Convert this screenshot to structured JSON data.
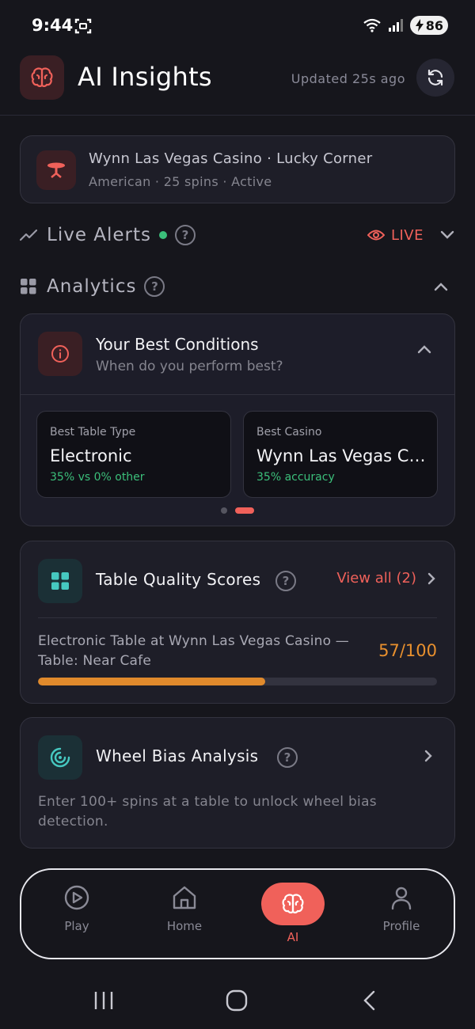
{
  "status_bar": {
    "time": "9:44",
    "battery": "86"
  },
  "header": {
    "title": "AI Insights",
    "updated": "Updated 25s ago"
  },
  "session": {
    "title": "Wynn Las Vegas Casino · Lucky Corner",
    "subtitle": "American · 25 spins · Active"
  },
  "live_alerts": {
    "title": "Live Alerts",
    "live_label": "LIVE"
  },
  "analytics": {
    "title": "Analytics"
  },
  "best_conditions": {
    "title": "Your Best Conditions",
    "subtitle": "When do you perform best?",
    "tiles": [
      {
        "label": "Best Table Type",
        "value": "Electronic",
        "note": "35% vs 0% other"
      },
      {
        "label": "Best Casino",
        "value": "Wynn Las Vegas Casino",
        "note": "35% accuracy"
      }
    ],
    "page_count": 2,
    "active_page": 1
  },
  "table_quality": {
    "title": "Table Quality Scores",
    "view_all": "View all (2)",
    "item_name": "Electronic Table at Wynn Las Vegas Casino — Table: Near Cafe",
    "score": "57/100",
    "score_fraction": 0.57
  },
  "wheel_bias": {
    "title": "Wheel Bias Analysis",
    "description": "Enter 100+ spins at a table to unlock wheel bias detection."
  },
  "nav": {
    "items": [
      {
        "label": "Play",
        "icon": "play-circle-icon"
      },
      {
        "label": "Home",
        "icon": "home-icon"
      },
      {
        "label": "AI",
        "icon": "brain-icon"
      },
      {
        "label": "Profile",
        "icon": "user-icon"
      }
    ],
    "active": "AI"
  },
  "colors": {
    "accent": "#f0615a",
    "success": "#3bbf7a",
    "warning": "#e8902e",
    "background": "#16161c"
  }
}
